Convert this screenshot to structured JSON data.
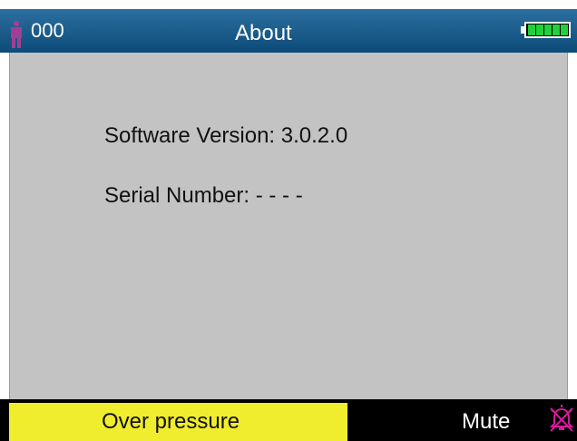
{
  "header": {
    "patient_id": "000",
    "title": "About",
    "patient_icon": "patient-figure-icon",
    "battery_icon": "battery-full-icon"
  },
  "about": {
    "software_version_line": "Software Version: 3.0.2.0",
    "serial_number_line": "Serial Number: - - - -"
  },
  "footer": {
    "alarm_message": "Over pressure",
    "mute_label": "Mute",
    "mute_icon": "alarm-muted-icon"
  },
  "colors": {
    "header_bg": "#0c4b78",
    "content_bg": "#c3c3c3",
    "alarm_bg": "#f0ec2e",
    "footer_bg": "#000000",
    "patient_icon": "#a23f93",
    "battery": "#22d13a",
    "mute_icon": "#d61a9a"
  }
}
